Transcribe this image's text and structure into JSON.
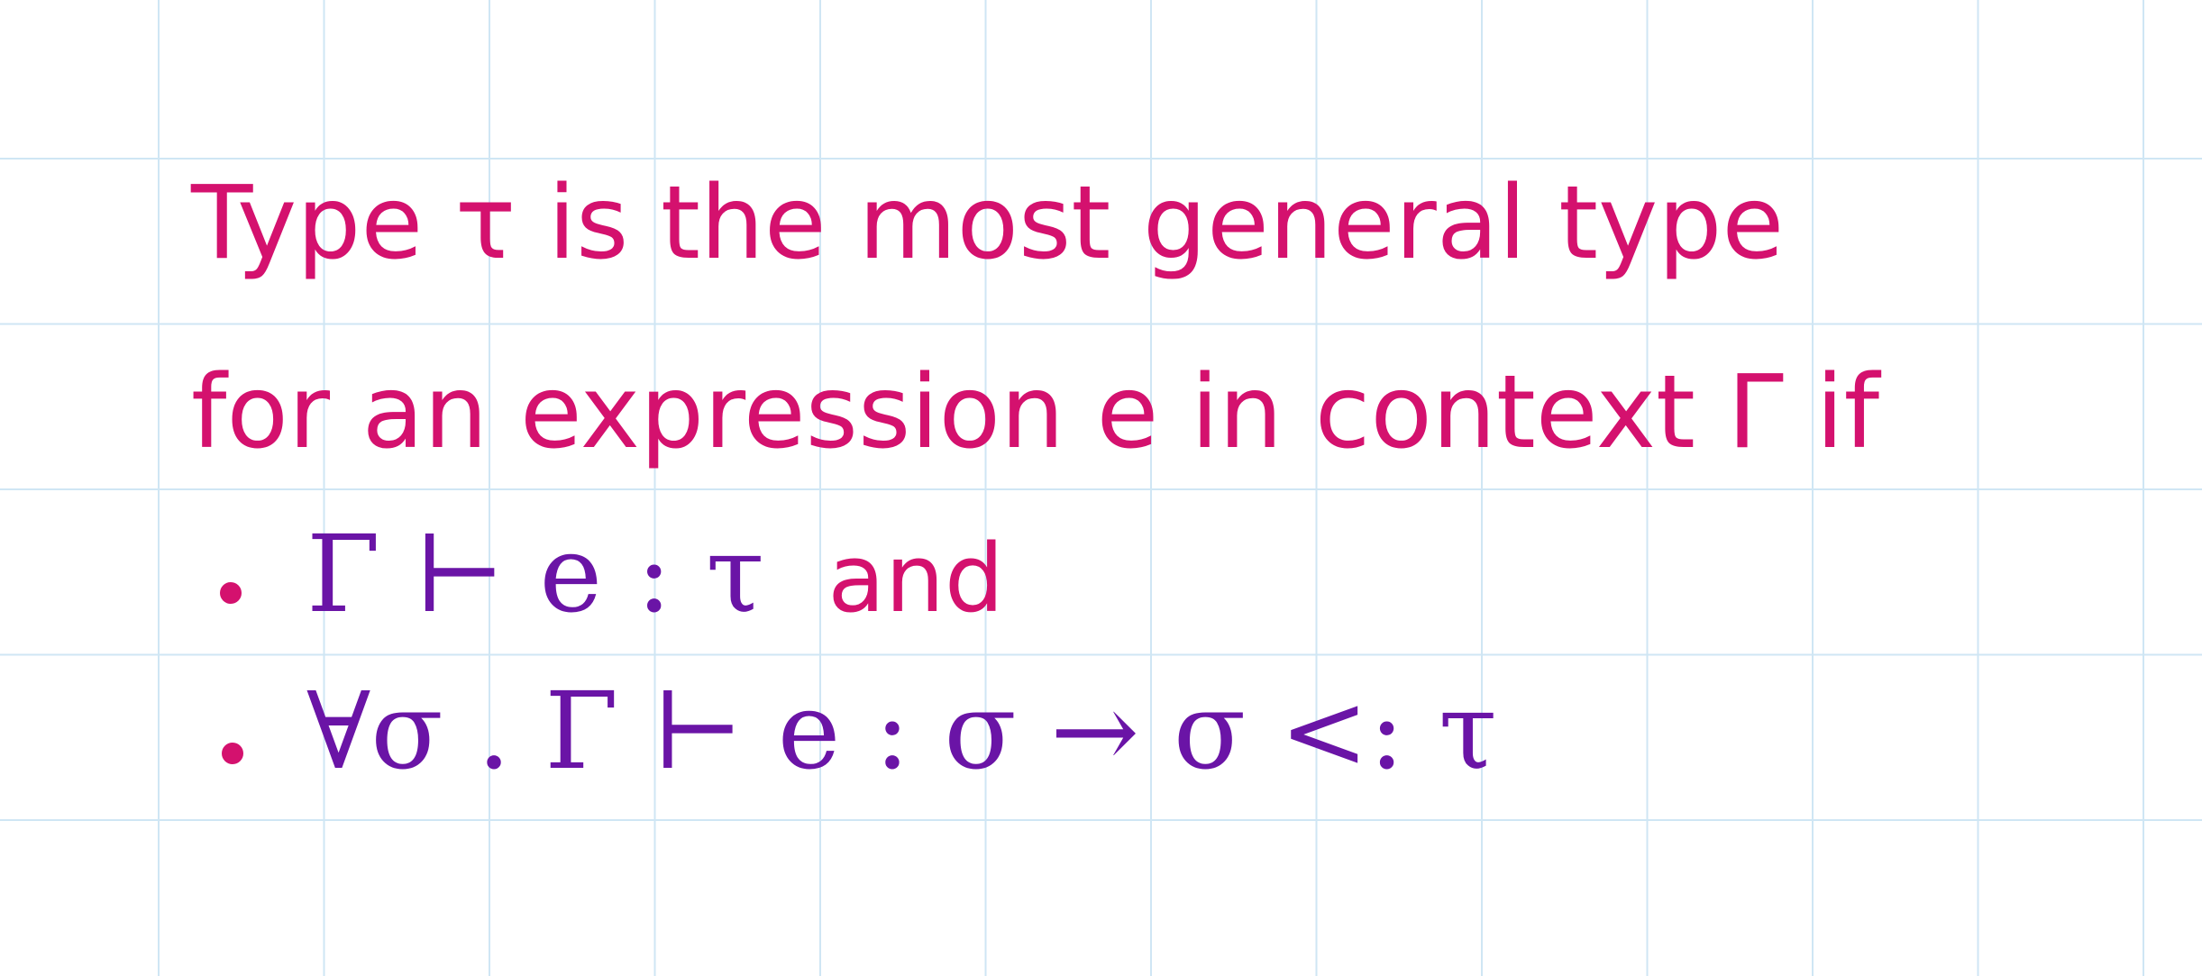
{
  "colors": {
    "paper": "#ffffff",
    "grid": "#cfe6f4",
    "prose": "#d4116e",
    "math": "#6a14a6",
    "bullet": "#d4116e"
  },
  "notes": {
    "line1": "Type τ is the most general type",
    "line2": "for an expression e in context Γ if",
    "bullet1_formula": "Γ ⊢ e : τ",
    "bullet1_conjunction": "and",
    "bullet2_formula": "∀σ . Γ ⊢ e : σ → σ <: τ"
  }
}
